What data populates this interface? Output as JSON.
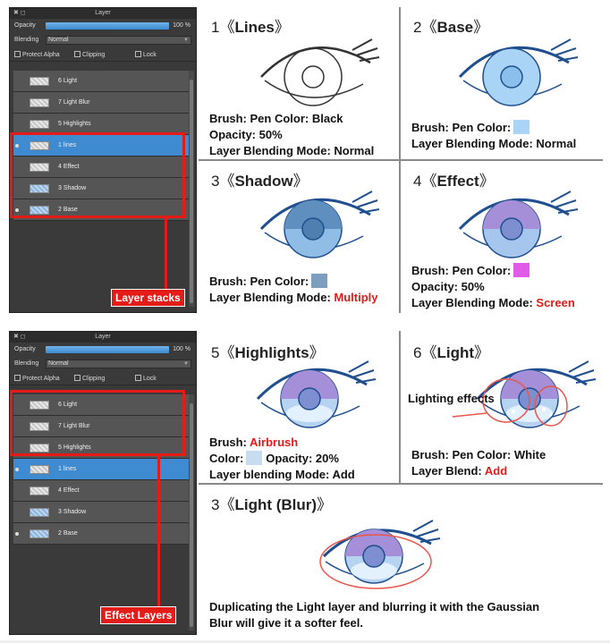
{
  "panel_top": {
    "title": "Layer",
    "window_controls": "✖ ◻",
    "opacity_label": "Opacity",
    "opacity_value": "100 %",
    "blending_label": "Blending",
    "blending_value": "Normal",
    "checkboxes": [
      "Protect Alpha",
      "Clipping",
      "Lock"
    ],
    "layers": [
      {
        "name": "6 Light"
      },
      {
        "name": "7 Light Blur"
      },
      {
        "name": "5 Highlights"
      },
      {
        "name": "1 lines"
      },
      {
        "name": "4 Effect"
      },
      {
        "name": "3 Shadow"
      },
      {
        "name": "2 Base"
      }
    ],
    "tag": "Layer stacks"
  },
  "panel_bottom": {
    "title": "Layer",
    "window_controls": "✖ ◻",
    "opacity_label": "Opacity",
    "opacity_value": "100 %",
    "blending_label": "Blending",
    "blending_value": "Normal",
    "checkboxes": [
      "Protect Alpha",
      "Clipping",
      "Lock"
    ],
    "layers": [
      {
        "name": "6 Light"
      },
      {
        "name": "7 Light Blur"
      },
      {
        "name": "5 Highlights"
      },
      {
        "name": "1 lines"
      },
      {
        "name": "4 Effect"
      },
      {
        "name": "3 Shadow"
      },
      {
        "name": "2 Base"
      }
    ],
    "tag": "Effect Layers"
  },
  "steps": {
    "lines": {
      "number": "1",
      "title": "Lines",
      "line1": "Brush: Pen    Color: Black",
      "line2": "Opacity: 50%",
      "line3": "Layer Blending Mode: Normal"
    },
    "base": {
      "number": "2",
      "title": "Base",
      "line1": "Brush: Pen    Color:",
      "line2": "Layer Blending Mode: Normal",
      "swatch": "#a9d4f5"
    },
    "shadow": {
      "number": "3",
      "title": "Shadow",
      "line1": "Brush: Pen    Color:",
      "line2_prefix": "Layer Blending Mode: ",
      "line2_red": "Multiply",
      "swatch": "#7c9fbf"
    },
    "effect": {
      "number": "4",
      "title": "Effect",
      "line1": "Brush: Pen    Color:",
      "line2": "Opacity: 50%",
      "line3_prefix": "Layer Blending Mode: ",
      "line3_red": "Screen",
      "swatch": "#e05ce8"
    },
    "highlights": {
      "number": "5",
      "title": "Highlights",
      "line1_prefix": "Brush:  ",
      "line1_red": "Airbrush",
      "line2_prefix": "Color:",
      "line2_suffix": "Opacity: 20%",
      "line3": "Layer blending Mode: Add",
      "swatch": "#c7dcef"
    },
    "light": {
      "number": "6",
      "title": "Light",
      "note": "Lighting effects",
      "line1": "Brush: Pen    Color: White",
      "line2_prefix": "Layer Blend: ",
      "line2_red": "Add"
    },
    "light_blur": {
      "number": "3",
      "title": "Light (Blur)",
      "line1": "Duplicating the Light layer and blurring it with the Gaussian",
      "line2": "Blur will give it a softer feel."
    }
  },
  "colors": {
    "accent_red": "#e41b17",
    "selected_layer": "#3f8bd2",
    "panel_bg": "#3a3a3a",
    "eye_line": "#1f4f8f"
  }
}
